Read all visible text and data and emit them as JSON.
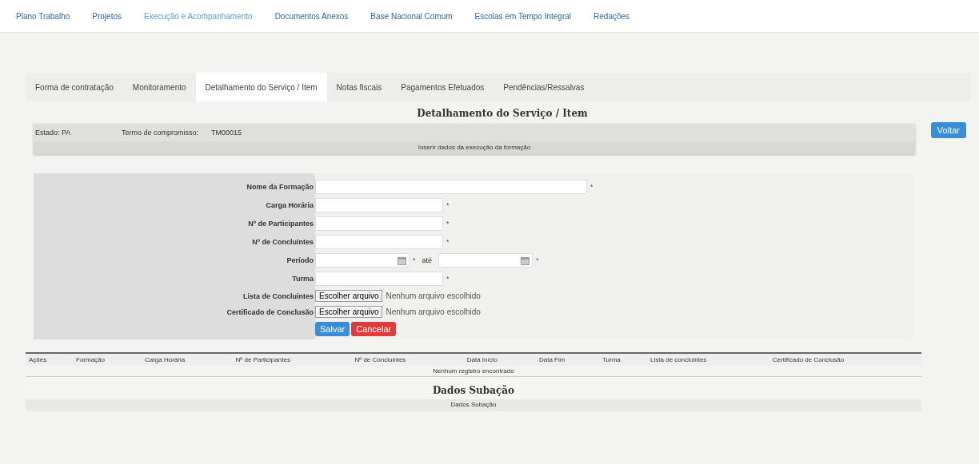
{
  "nav": [
    {
      "label": "Plano Trabalho",
      "selected": false
    },
    {
      "label": "Projetos",
      "selected": false
    },
    {
      "label": "Execução e Acompanhamento",
      "selected": true
    },
    {
      "label": "Documentos Anexos",
      "selected": false
    },
    {
      "label": "Base Nacional Comum",
      "selected": false
    },
    {
      "label": "Escolas em Tempo Integral",
      "selected": false
    },
    {
      "label": "Redações",
      "selected": false
    }
  ],
  "tabs": [
    {
      "label": "Forma de contratação",
      "selected": false
    },
    {
      "label": "Monitoramento",
      "selected": false
    },
    {
      "label": "Detalhamento do Serviço / Item",
      "selected": true
    },
    {
      "label": "Notas fiscais",
      "selected": false
    },
    {
      "label": "Pagamentos Efetuados",
      "selected": false
    },
    {
      "label": "Pendências/Ressalvas",
      "selected": false
    }
  ],
  "header": {
    "title": "Detalhamento do Serviço / Item",
    "state": "Estado: PA",
    "term_label": "Termo de compromisso:",
    "term_value": "TM00015",
    "subtitle": "Inserir dados da execução da formação",
    "back_button": "Voltar"
  },
  "form": {
    "fields": [
      {
        "kind": "text",
        "label": "Nome da Formação",
        "wide": true,
        "required": "*"
      },
      {
        "kind": "text",
        "label": "Carga Horária",
        "wide": false,
        "required": "*"
      },
      {
        "kind": "text",
        "label": "Nº de Participantes",
        "wide": false,
        "required": "*"
      },
      {
        "kind": "text",
        "label": "Nº de Concluintes",
        "wide": false,
        "required": "*"
      },
      {
        "kind": "daterange",
        "label": "Período",
        "required": "*",
        "separator": "até",
        "required_end": "*"
      },
      {
        "kind": "text",
        "label": "Turma",
        "wide": false,
        "required": "*"
      },
      {
        "kind": "file",
        "label": "Lista de Concluintes",
        "button": "Escolher arquivo",
        "status": "Nenhum arquivo escolhido"
      },
      {
        "kind": "file",
        "label": "Certificado de Conclusão",
        "button": "Escolher arquivo",
        "status": "Nenhum arquivo escolhido"
      }
    ],
    "save_button": "Salvar",
    "cancel_button": "Cancelar"
  },
  "table": {
    "columns": [
      "Ações",
      "Formação",
      "Carga Horária",
      "Nº de Participantes",
      "Nº de Concluintes",
      "Data Início",
      "Data Fim",
      "Turma",
      "Lista de concluintes",
      "Certificado de Conclusão"
    ],
    "empty_message": "Nenhum registro encontrado"
  },
  "footer": {
    "title": "Dados Subação",
    "subtitle": "Dados Subação"
  }
}
